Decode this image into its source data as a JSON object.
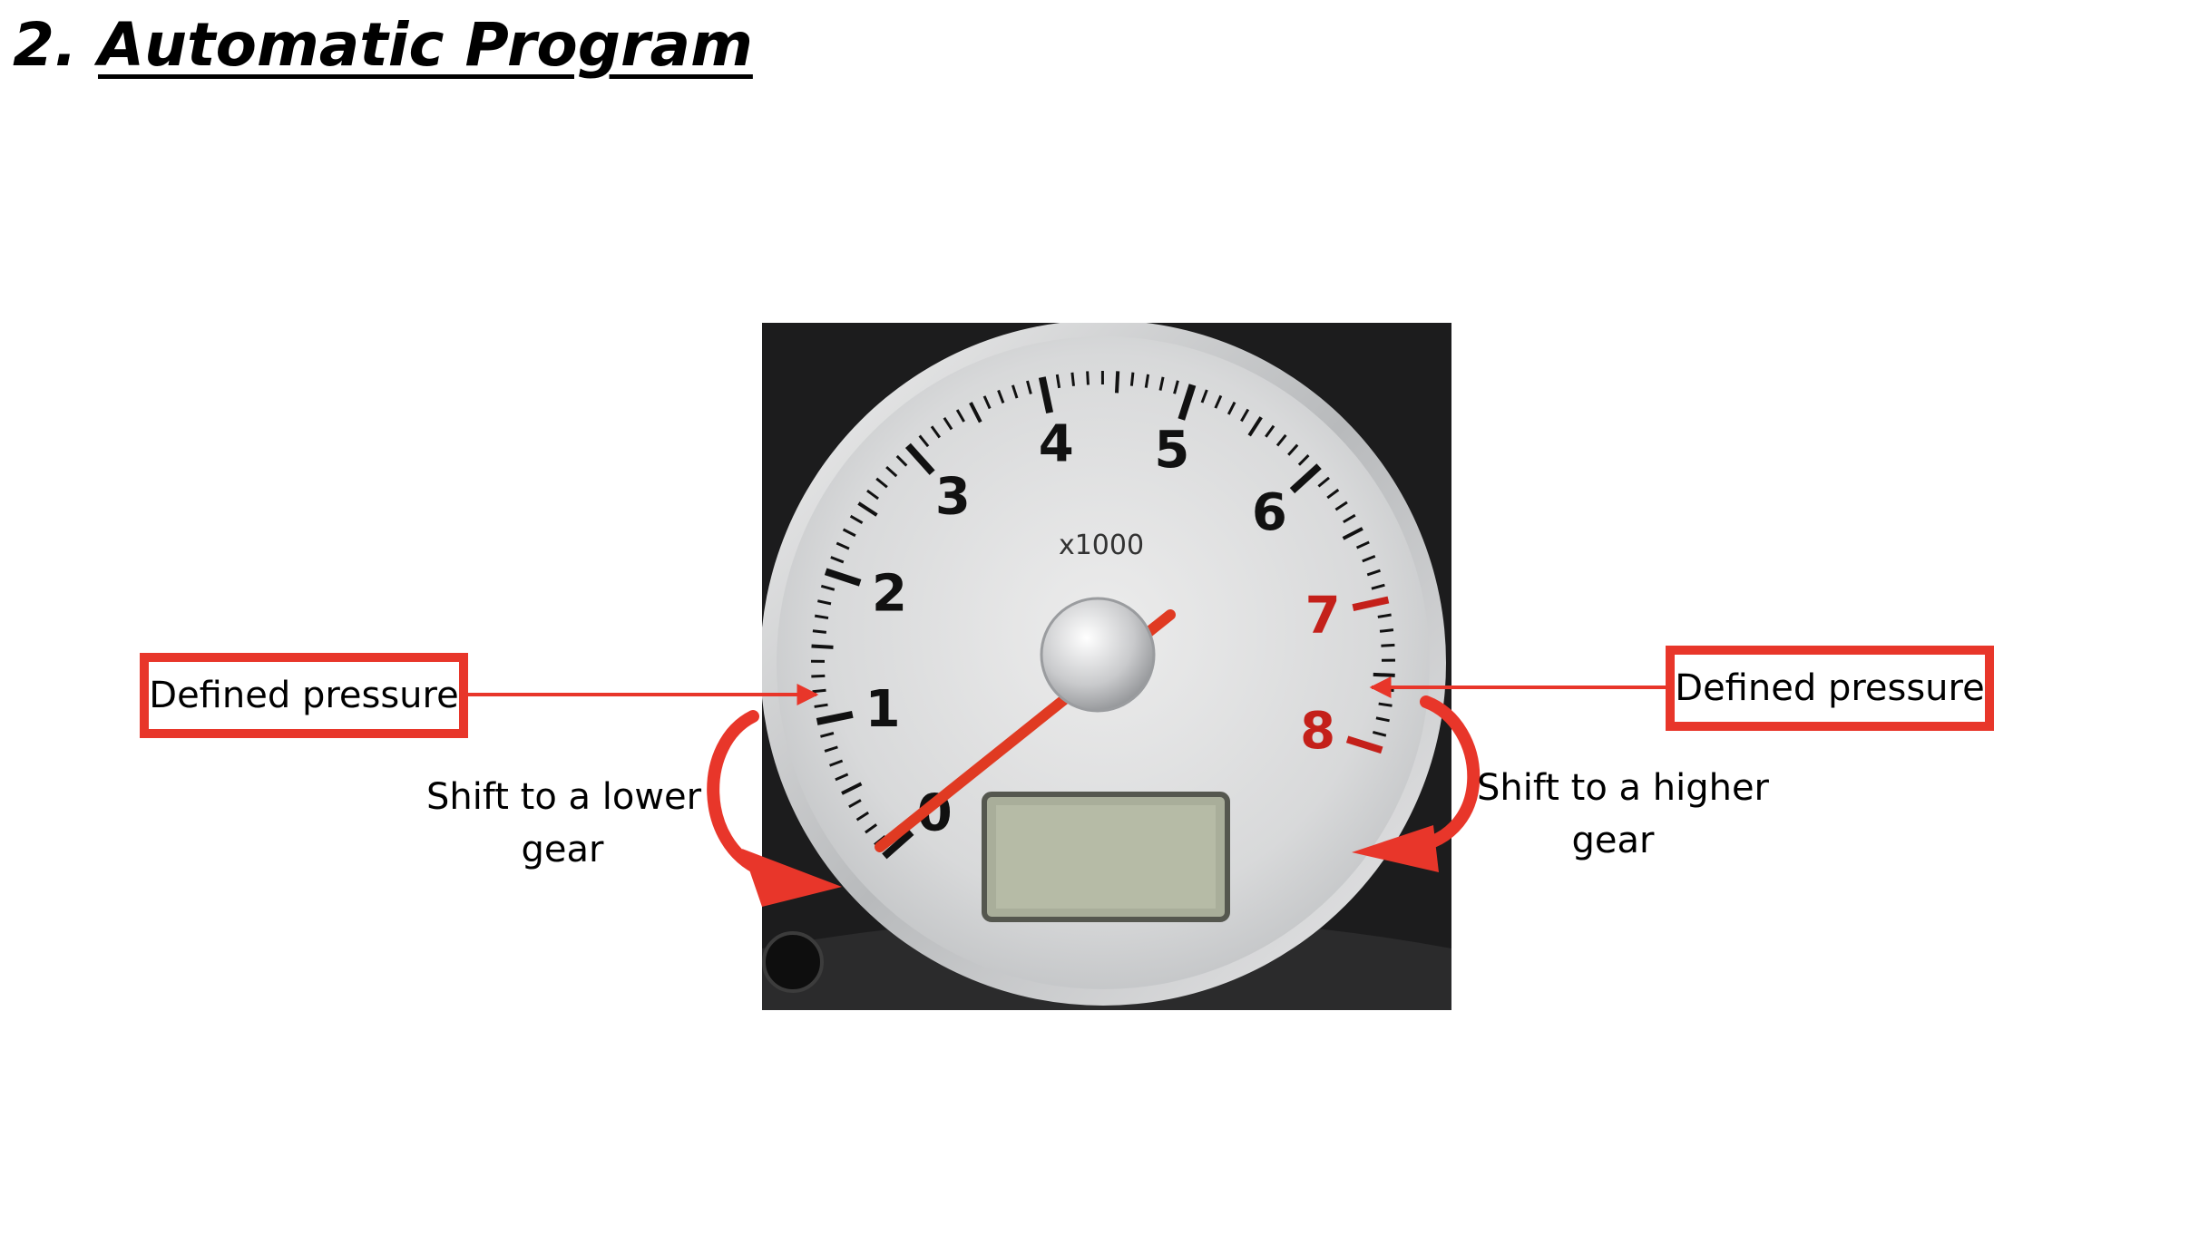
{
  "slide": {
    "title_number": "2.",
    "title_text": "Automatic Program"
  },
  "gauge": {
    "unit_label": "x1000",
    "dial_numbers": [
      "0",
      "1",
      "2",
      "3",
      "4",
      "5",
      "6",
      "7",
      "8"
    ],
    "redline_numbers": [
      "7",
      "8"
    ],
    "needle_value": 0,
    "colors": {
      "face": "#d9dadb",
      "bezel": "#1a1a1a",
      "numerals": "#111111",
      "redline": "#c4201a",
      "needle": "#e03a22"
    }
  },
  "annotations": {
    "left_box": "Defined pressure",
    "right_box": "Defined pressure",
    "left_note_line1": "Shift to a lower",
    "left_note_line2": "gear",
    "right_note_line1": "Shift to a higher",
    "right_note_line2": "gear",
    "accent_color": "#e8362a"
  }
}
